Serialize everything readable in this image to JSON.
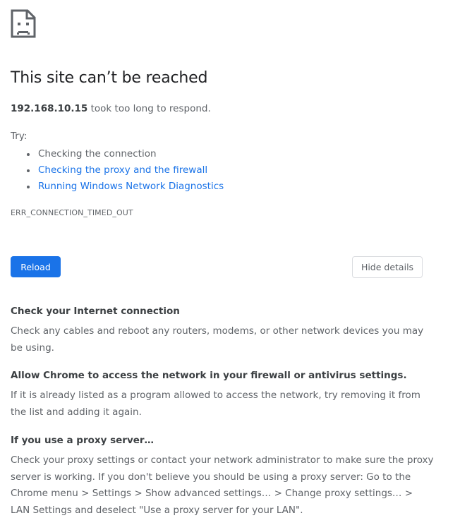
{
  "error": {
    "icon": "sad-page-icon",
    "title": "This site can’t be reached",
    "host": "192.168.10.15",
    "summary_suffix": " took too long to respond.",
    "try_label": "Try:",
    "suggestions": [
      {
        "label": "Checking the connection",
        "link": false
      },
      {
        "label": "Checking the proxy and the firewall",
        "link": true
      },
      {
        "label": "Running Windows Network Diagnostics",
        "link": true
      }
    ],
    "code": "ERR_CONNECTION_TIMED_OUT"
  },
  "buttons": {
    "reload_label": "Reload",
    "details_label": "Hide details"
  },
  "details": [
    {
      "heading": "Check your Internet connection",
      "text": "Check any cables and reboot any routers, modems, or other network devices you may be using."
    },
    {
      "heading": "Allow Chrome to access the network in your firewall or antivirus settings.",
      "text": "If it is already listed as a program allowed to access the network, try removing it from the list and adding it again."
    },
    {
      "heading": "If you use a proxy server…",
      "text": "Check your proxy settings or contact your network administrator to make sure the proxy server is working. If you don't believe you should be using a proxy server: Go to the Chrome menu > Settings > Show advanced settings… > Change proxy settings… > LAN Settings and deselect \"Use a proxy server for your LAN\"."
    }
  ],
  "colors": {
    "accent": "#1a73e8",
    "title_text": "#202124",
    "body_text": "#5f6368"
  }
}
